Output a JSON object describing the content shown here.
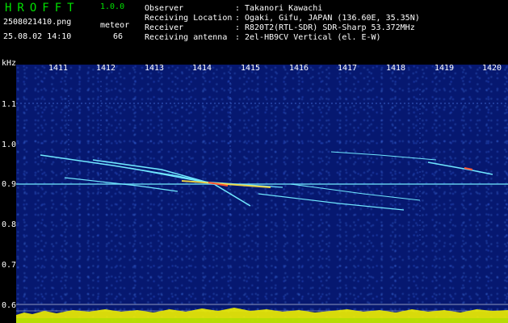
{
  "header": {
    "app_title": "HROFFT",
    "app_version": "1.0.0",
    "filename": "2508021410.png",
    "datetime": "25.08.02 14:10",
    "meteor_label": "meteor",
    "meteor_count": "66",
    "info": [
      {
        "key": "Observer",
        "sep": ":",
        "value": "Takanori Kawachi"
      },
      {
        "key": "Receiving Location",
        "sep": ":",
        "value": "Ogaki, Gifu, JAPAN (136.60E, 35.35N)"
      },
      {
        "key": "Receiver",
        "sep": ":",
        "value": "R820T2(RTL-SDR) SDR-Sharp 53.372MHz"
      },
      {
        "key": "Receiving antenna",
        "sep": ":",
        "value": "2el-HB9CV Vertical (el. E-W)"
      }
    ]
  },
  "axes": {
    "unit": "kHz",
    "y_ticks": [
      "1.1",
      "1.0",
      "0.9",
      "0.8",
      "0.7",
      "0.6"
    ],
    "x_ticks": [
      "1411",
      "1412",
      "1413",
      "1414",
      "1415",
      "1416",
      "1417",
      "1418",
      "1419",
      "1420"
    ]
  },
  "colors": {
    "background": "#000000",
    "title_green": "#00e000",
    "plot_blue": "#061870",
    "trace_cyan": "#70e8ff",
    "power_yellow": "#f0f000"
  }
}
